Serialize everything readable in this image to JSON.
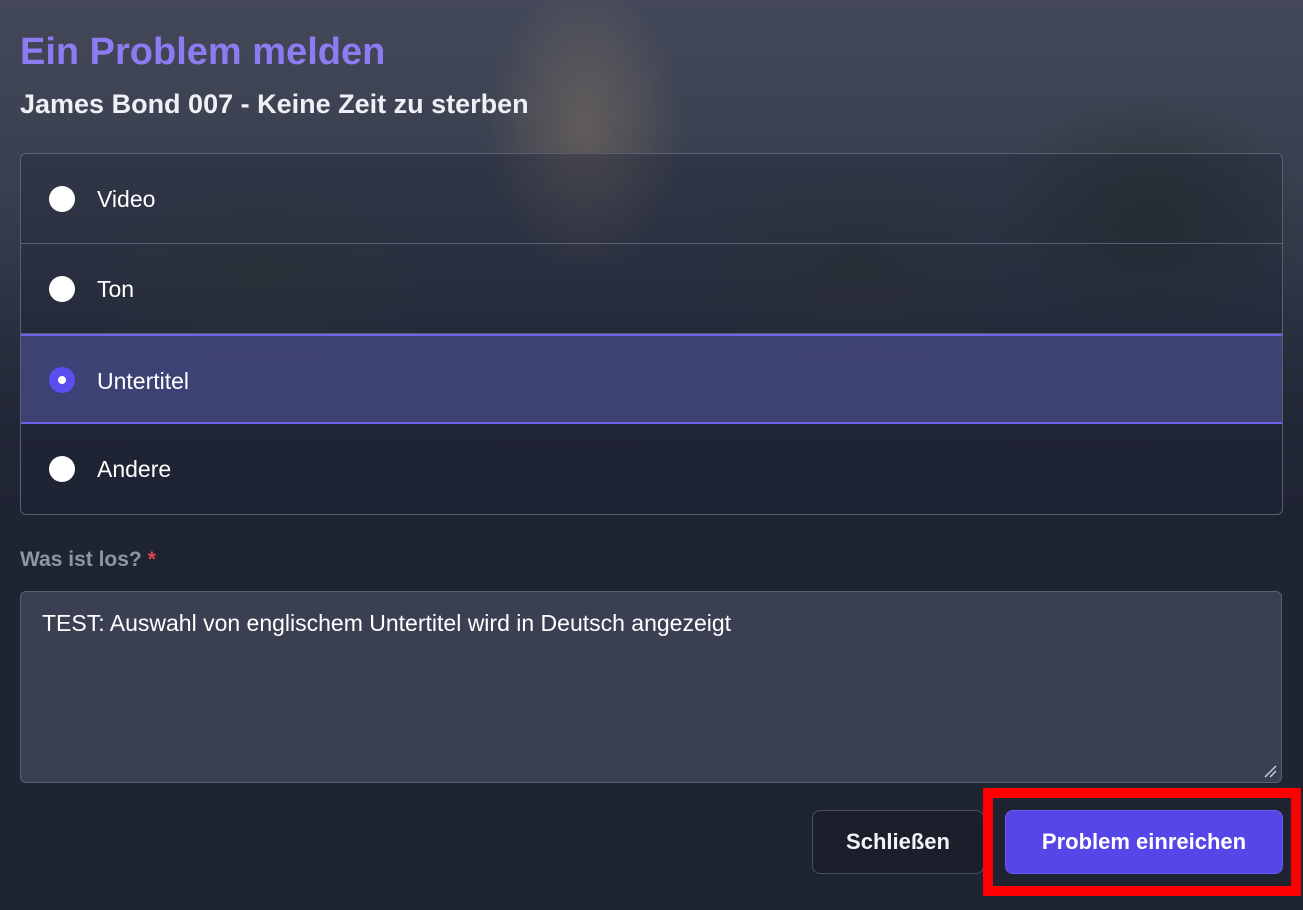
{
  "dialog": {
    "title": "Ein Problem melden",
    "subtitle": "James Bond 007 - Keine Zeit zu sterben"
  },
  "options": {
    "selected": "Untertitel",
    "items": [
      {
        "label": "Video",
        "selected": false
      },
      {
        "label": "Ton",
        "selected": false
      },
      {
        "label": "Untertitel",
        "selected": true
      },
      {
        "label": "Andere",
        "selected": false
      }
    ]
  },
  "description": {
    "label": "Was ist los?",
    "required_marker": "*",
    "value": "TEST: Auswahl von englischem Untertitel wird in Deutsch angezeigt"
  },
  "buttons": {
    "close_label": "Schließen",
    "submit_label": "Problem einreichen"
  },
  "colors": {
    "accent": "#5646e8",
    "title": "#8b7cf2",
    "required": "#e0464e",
    "highlight": "#ff0000"
  }
}
